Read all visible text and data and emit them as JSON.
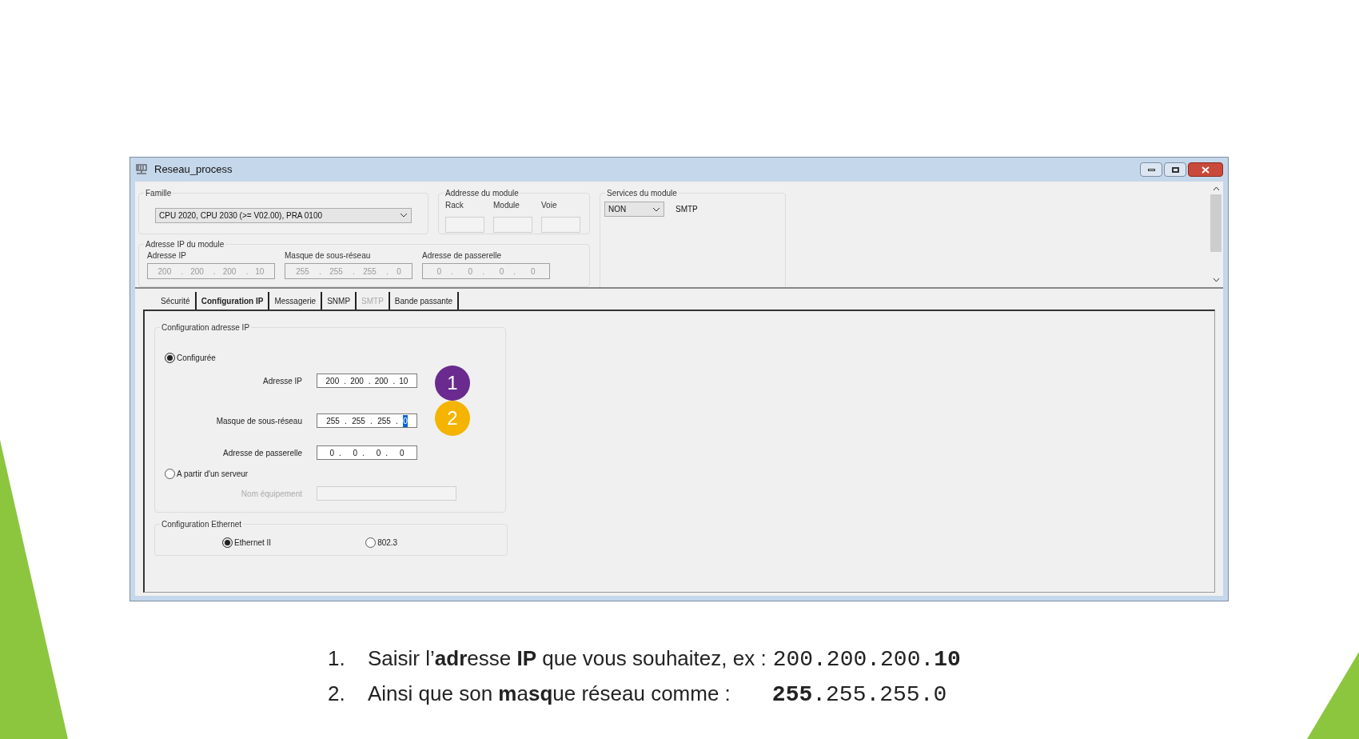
{
  "window": {
    "title": "Reseau_process"
  },
  "famille": {
    "label": "Famille",
    "value": "CPU 2020, CPU 2030 (>= V02.00), PRA 0100"
  },
  "module_address": {
    "label": "Addresse du module",
    "fields": [
      "Rack",
      "Module",
      "Voie"
    ]
  },
  "services": {
    "label": "Services du module",
    "value": "NON",
    "text": "SMTP"
  },
  "ip_module": {
    "label": "Adresse IP du module",
    "separator": ".",
    "fields": [
      {
        "label": "Adresse IP",
        "octets": [
          "200",
          "200",
          "200",
          "10"
        ]
      },
      {
        "label": "Masque de sous-réseau",
        "octets": [
          "255",
          "255",
          "255",
          "0"
        ]
      },
      {
        "label": "Adresse de passerelle",
        "octets": [
          "0",
          "0",
          "0",
          "0"
        ]
      }
    ]
  },
  "tabs": [
    {
      "label": "Sécurité",
      "selected": false,
      "disabled": false
    },
    {
      "label": "Configuration IP",
      "selected": true,
      "disabled": false
    },
    {
      "label": "Messagerie",
      "selected": false,
      "disabled": false
    },
    {
      "label": "SNMP",
      "selected": false,
      "disabled": false
    },
    {
      "label": "SMTP",
      "selected": false,
      "disabled": true
    },
    {
      "label": "Bande passante",
      "selected": false,
      "disabled": false
    }
  ],
  "ip_config": {
    "label": "Configuration adresse IP",
    "separator": ".",
    "options": [
      {
        "label": "Configurée",
        "selected": true
      },
      {
        "label": "A partir d'un serveur",
        "selected": false
      }
    ],
    "fields": [
      {
        "label": "Adresse IP",
        "octets": [
          {
            "text": "200",
            "selected": false
          },
          {
            "text": "200",
            "selected": false
          },
          {
            "text": "200",
            "selected": false
          },
          {
            "text": "10",
            "selected": false
          }
        ]
      },
      {
        "label": "Masque de sous-réseau",
        "octets": [
          {
            "text": "255",
            "selected": false
          },
          {
            "text": "255",
            "selected": false
          },
          {
            "text": "255",
            "selected": false
          },
          {
            "text": "0",
            "selected": true
          }
        ]
      },
      {
        "label": "Adresse de passerelle",
        "octets": [
          {
            "text": "0",
            "selected": false
          },
          {
            "text": "0",
            "selected": false
          },
          {
            "text": "0",
            "selected": false
          },
          {
            "text": "0",
            "selected": false
          }
        ]
      }
    ],
    "server_field": {
      "label": "Nom équipement",
      "disabled": true
    }
  },
  "badges": [
    {
      "text": "1",
      "color": "#6a2a8f"
    },
    {
      "text": "2",
      "color": "#f4b400"
    }
  ],
  "ethernet": {
    "label": "Configuration Ethernet",
    "options": [
      {
        "label": "Ethernet II",
        "selected": true
      },
      {
        "label": "802.3",
        "selected": false
      }
    ]
  },
  "steps": [
    {
      "number": "1.",
      "text": "Saisir l’**adr**esse **IP** que vous souhaitez, ex :",
      "value": "200.200.200.**10**"
    },
    {
      "number": "2.",
      "text": "Ainsi que son **m**a**sq**ue réseau comme :",
      "value": "**255**.255.255.0"
    }
  ]
}
